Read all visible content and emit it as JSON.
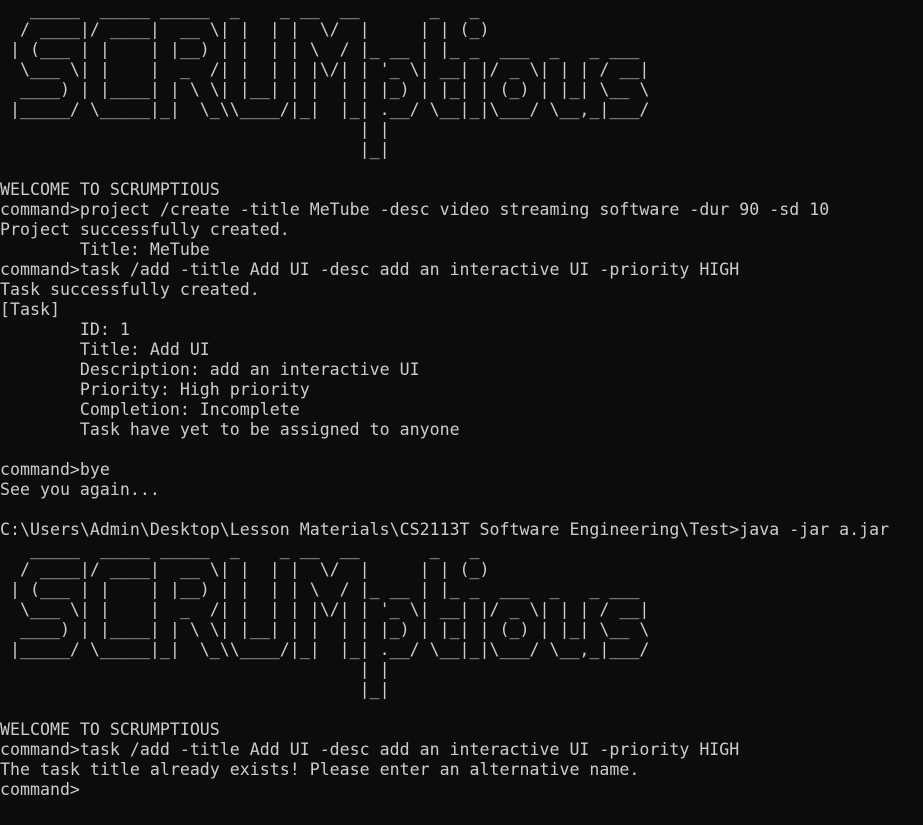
{
  "terminal": {
    "logo_1": [
      "   _____  _____ _____  _    _ __  __       _   _ ",
      "  / ____|/ ____|  __ \\| |  | |  \\/  |     | | (_)",
      " | (___ | |    | |__) | |  | | \\  / |_ __ | |_ _  ___  _   _ ___ ",
      "  \\___ \\| |    |  _  /| |  | | |\\/| | '_ \\| __| |/ _ \\| | | / __|",
      "  ____) | |____| | \\ \\| |__| | |  | | |_) | |_| | (_) | |_| \\__ \\",
      " |_____/ \\_____|_|  \\_\\\\____/|_|  |_| .__/ \\__|_|\\___/ \\__,_|___/",
      "                                    | |",
      "                                    |_|"
    ],
    "session_1": [
      "",
      "WELCOME TO SCRUMPTIOUS",
      "command>project /create -title MeTube -desc video streaming software -dur 90 -sd 10",
      "Project successfully created.",
      "        Title: MeTube",
      "command>task /add -title Add UI -desc add an interactive UI -priority HIGH",
      "Task successfully created.",
      "[Task]",
      "        ID: 1",
      "        Title: Add UI",
      "        Description: add an interactive UI",
      "        Priority: High priority",
      "        Completion: Incomplete",
      "        Task have yet to be assigned to anyone",
      "",
      "command>bye",
      "See you again...",
      "",
      "C:\\Users\\Admin\\Desktop\\Lesson Materials\\CS2113T Software Engineering\\Test>java -jar a.jar"
    ],
    "logo_2": [
      "   _____  _____ _____  _    _ __  __       _   _ ",
      "  / ____|/ ____|  __ \\| |  | |  \\/  |     | | (_)",
      " | (___ | |    | |__) | |  | | \\  / |_ __ | |_ _  ___  _   _ ___ ",
      "  \\___ \\| |    |  _  /| |  | | |\\/| | '_ \\| __| |/ _ \\| | | / __|",
      "  ____) | |____| | \\ \\| |__| | |  | | |_) | |_| | (_) | |_| \\__ \\",
      " |_____/ \\_____|_|  \\_\\\\____/|_|  |_| .__/ \\__|_|\\___/ \\__,_|___/",
      "                                    | |",
      "                                    |_|"
    ],
    "session_2": [
      "",
      "WELCOME TO SCRUMPTIOUS",
      "command>task /add -title Add UI -desc add an interactive UI -priority HIGH",
      "The task title already exists! Please enter an alternative name.",
      "command>"
    ],
    "colors": {
      "background": "#0c0c0c",
      "foreground": "#cccccc"
    }
  }
}
